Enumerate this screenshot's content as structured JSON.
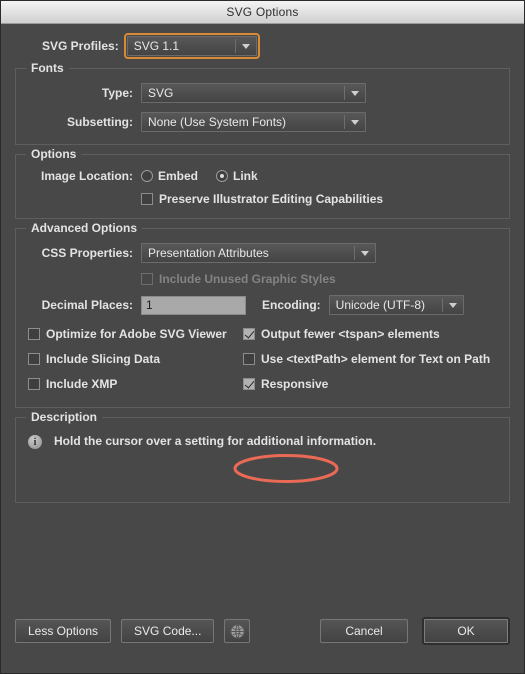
{
  "window": {
    "title": "SVG Options"
  },
  "profile": {
    "label": "SVG Profiles:",
    "value": "SVG 1.1"
  },
  "fonts": {
    "title": "Fonts",
    "type_label": "Type:",
    "type_value": "SVG",
    "subsetting_label": "Subsetting:",
    "subsetting_value": "None (Use System Fonts)"
  },
  "options": {
    "title": "Options",
    "image_location_label": "Image Location:",
    "embed_label": "Embed",
    "link_label": "Link",
    "preserve_label": "Preserve Illustrator Editing Capabilities"
  },
  "advanced": {
    "title": "Advanced Options",
    "css_label": "CSS Properties:",
    "css_value": "Presentation Attributes",
    "unused_styles_label": "Include Unused Graphic Styles",
    "decimal_label": "Decimal Places:",
    "decimal_value": "1",
    "encoding_label": "Encoding:",
    "encoding_value": "Unicode (UTF-8)",
    "checkboxes": {
      "optimize": "Optimize for Adobe SVG Viewer",
      "output_fewer": "Output fewer <tspan> elements",
      "slicing": "Include Slicing Data",
      "textpath": "Use <textPath> element for Text on Path",
      "xmp": "Include XMP",
      "responsive": "Responsive"
    }
  },
  "description": {
    "title": "Description",
    "icon": "info-icon",
    "text": "Hold the cursor over a setting for additional information."
  },
  "footer": {
    "less_options": "Less Options",
    "svg_code": "SVG Code...",
    "globe_icon": "globe-icon",
    "cancel": "Cancel",
    "ok": "OK"
  },
  "annotation": {
    "shape": "ellipse",
    "color": "#ea6a55",
    "target": "Responsive"
  },
  "colors": {
    "dialog_bg": "#484848",
    "titlebar_top": "#f4f4f4",
    "titlebar_bottom": "#cfcfcf",
    "focus_ring": "#d98b34",
    "annotation": "#ea6a55",
    "text": "#e3e3e3",
    "disabled_text": "#838383"
  }
}
